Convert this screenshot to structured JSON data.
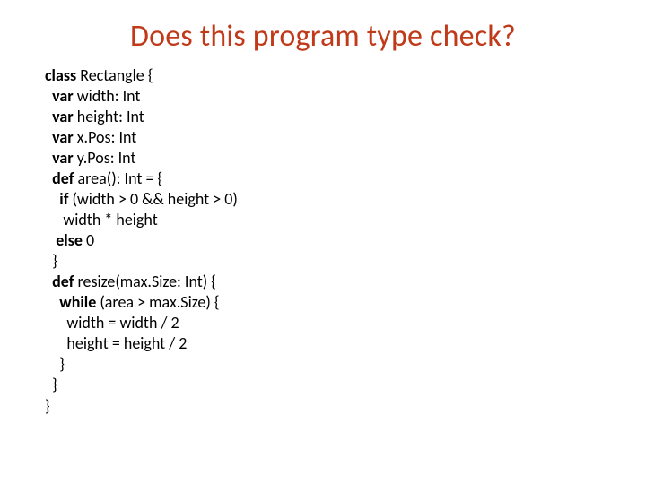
{
  "title": "Does this program type check?",
  "code": {
    "l1a": "class",
    "l1b": " Rectangle {",
    "l2a": "  var",
    "l2b": " width: Int",
    "l3a": "  var",
    "l3b": " height: Int",
    "l4a": "  var",
    "l4b": " x.Pos: Int",
    "l5a": "  var",
    "l5b": " y.Pos: Int",
    "l6a": "  def",
    "l6b": " area(): Int = {",
    "l7a": "    if",
    "l7b": " (width > 0 && height > 0)",
    "l8": "     width * height",
    "l9a": "   else",
    "l9b": " 0",
    "l10": "  }",
    "l11a": "  def",
    "l11b": " resize(max.Size: Int) {",
    "l12a": "    while",
    "l12b": " (area > max.Size) {",
    "l13": "      width = width / 2",
    "l14": "      height = height / 2",
    "l15": "    }",
    "l16": "  }",
    "l17": "}"
  }
}
